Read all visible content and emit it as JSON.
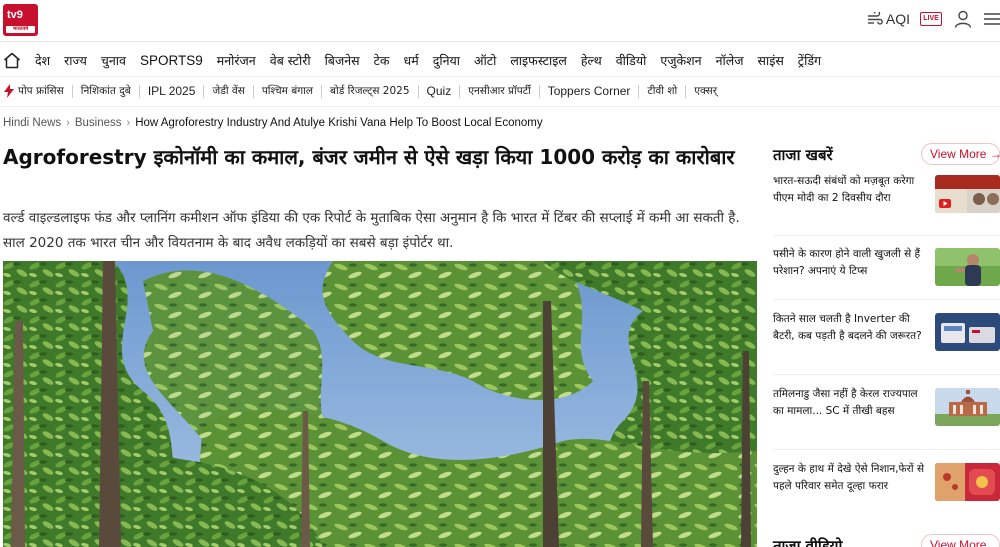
{
  "header": {
    "logo_text": "tv9",
    "logo_sub": "भारतवर्ष",
    "aqi_label": "AQI",
    "live_label": "LIVE"
  },
  "nav_primary": [
    "देश",
    "राज्य",
    "चुनाव",
    "SPORTS9",
    "मनोरंजन",
    "वेब स्टोरी",
    "बिजनेस",
    "टेक",
    "धर्म",
    "दुनिया",
    "ऑटो",
    "लाइफस्टाइल",
    "हेल्थ",
    "वीडियो",
    "एजुकेशन",
    "नॉलेज",
    "साइंस",
    "ट्रेंडिंग"
  ],
  "nav_secondary": [
    "पोप फ्रांसिस",
    "निशिकांत दुबे",
    "IPL 2025",
    "जेडी वेंस",
    "पश्चिम बंगाल",
    "बोर्ड रिजल्ट्स 2025",
    "Quiz",
    "एनसीआर प्रॉपर्टी",
    "Toppers Corner",
    "टीवी शो",
    "एक्सर्"
  ],
  "breadcrumb": {
    "home": "Hindi News",
    "section": "Business",
    "current": "How Agroforestry Industry And Atulye Krishi Vana Help To Boost Local Economy"
  },
  "article": {
    "headline": "Agroforestry इकोनॉमी का कमाल, बंजर जमीन से ऐसे खड़ा किया 1000 करोड़ का कारोबार",
    "summary": "वर्ल्ड वाइल्डलाइफ फंड और प्लानिंग कमीशन ऑफ इंडिया की एक रिपोर्ट के मुताबिक ऐसा अनुमान है कि भारत में टिंबर की सप्लाई में कमी आ सकती है. साल 2020 तक भारत चीन और वियतनाम के बाद अवैध लकड़ियों का सबसे बड़ा इंपोर्टर था."
  },
  "sidebar": {
    "title": "ताजा खबरें",
    "view_more": "View More →",
    "items": [
      {
        "text": "भारत-सऊदी संबंधों को मज़बूत करेगा पीएम मोदी का 2 दिवसीय दौरा",
        "thumb": "video-thumb"
      },
      {
        "text": "पसीने के कारण होने वाली खुजली से हैं परेशान? अपनाएं ये टिप्स",
        "thumb": "health-thumb"
      },
      {
        "text": "कितने साल चलती है Inverter की बैटरी, कब पड़ती है बदलने की जरूरत?",
        "thumb": "inverter-thumb"
      },
      {
        "text": "तमिलनाडु जैसा नहीं है केरल राज्यपाल का मामला... SC में तीखी बहस",
        "thumb": "court-thumb"
      },
      {
        "text": "दुल्हन के हाथ में देखे ऐसे निशान,फेरों से पहले परिवार समेत दूल्हा फरार",
        "thumb": "wedding-thumb"
      }
    ],
    "title2": "ताज़ा वीडियो",
    "view_more2": "View More →"
  },
  "colors": {
    "brand_red": "#c8102e",
    "text": "#111111",
    "muted": "#555555"
  }
}
